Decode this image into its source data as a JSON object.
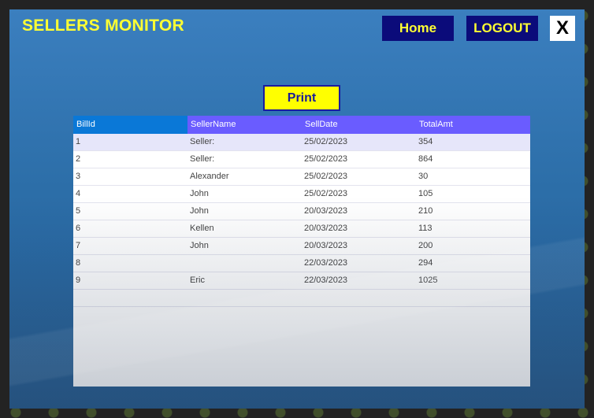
{
  "app": {
    "title": "SELLERS MONITOR"
  },
  "nav": {
    "home_label": "Home",
    "logout_label": "LOGOUT",
    "close_label": "X"
  },
  "actions": {
    "print_label": "Print"
  },
  "table": {
    "columns": [
      "BillId",
      "SellerName",
      "SellDate",
      "TotalAmt"
    ],
    "rows": [
      {
        "bill_id": "1",
        "seller_name": "Seller:",
        "sell_date": "25/02/2023",
        "total_amt": "354"
      },
      {
        "bill_id": "2",
        "seller_name": "Seller:",
        "sell_date": "25/02/2023",
        "total_amt": "864"
      },
      {
        "bill_id": "3",
        "seller_name": "Alexander",
        "sell_date": "25/02/2023",
        "total_amt": "30"
      },
      {
        "bill_id": "4",
        "seller_name": "John",
        "sell_date": "25/02/2023",
        "total_amt": "105"
      },
      {
        "bill_id": "5",
        "seller_name": "John",
        "sell_date": "20/03/2023",
        "total_amt": "210"
      },
      {
        "bill_id": "6",
        "seller_name": "Kellen",
        "sell_date": "20/03/2023",
        "total_amt": "113"
      },
      {
        "bill_id": "7",
        "seller_name": "John",
        "sell_date": "20/03/2023",
        "total_amt": "200"
      },
      {
        "bill_id": "8",
        "seller_name": "",
        "sell_date": "22/03/2023",
        "total_amt": "294"
      },
      {
        "bill_id": "9",
        "seller_name": "Eric",
        "sell_date": "22/03/2023",
        "total_amt": "1025"
      },
      {
        "bill_id": "",
        "seller_name": "",
        "sell_date": "",
        "total_amt": ""
      }
    ]
  },
  "colors": {
    "title_yellow": "#ffff33",
    "nav_button_bg": "#0b0b7a",
    "header_bg": "#6a5cff",
    "header_first_cell_bg": "#0a78d7",
    "selected_row_bg": "#e6e6fa",
    "print_button_bg": "#ffff00"
  }
}
